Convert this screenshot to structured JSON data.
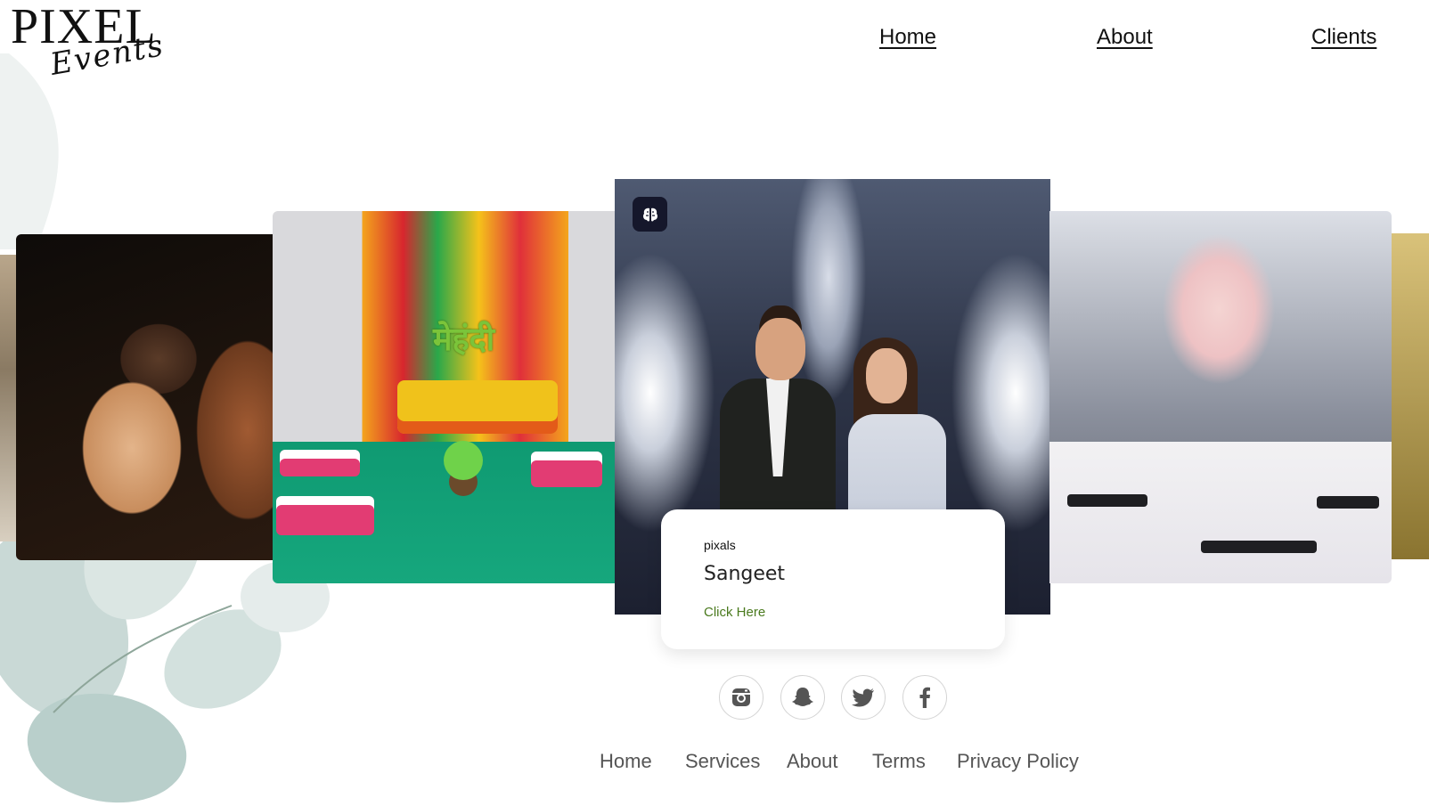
{
  "brand": {
    "logo_main": "PIXEL",
    "logo_script": "Events"
  },
  "nav": {
    "home": "Home",
    "about": "About",
    "clients": "Clients"
  },
  "carousel": {
    "slides": [
      {
        "name": "Haldi ceremony photo"
      },
      {
        "name": "Mehendi decor photo",
        "sign_text": "मेहंदी"
      },
      {
        "name": "Sangeet couple photo",
        "active": true
      },
      {
        "name": "Reception table decor photo"
      }
    ],
    "active_card": {
      "tag": "pixals",
      "title": "Sangeet",
      "link": "Click Here"
    }
  },
  "social": [
    "instagram-icon",
    "snapchat-icon",
    "twitter-icon",
    "facebook-icon"
  ],
  "footer": {
    "home": "Home",
    "services": "Services",
    "about": "About",
    "terms": "Terms",
    "privacy": "Privacy Policy"
  },
  "colors": {
    "link_green": "#4a7a1e",
    "badge_dark": "#15172b",
    "footer_text": "#555555"
  }
}
